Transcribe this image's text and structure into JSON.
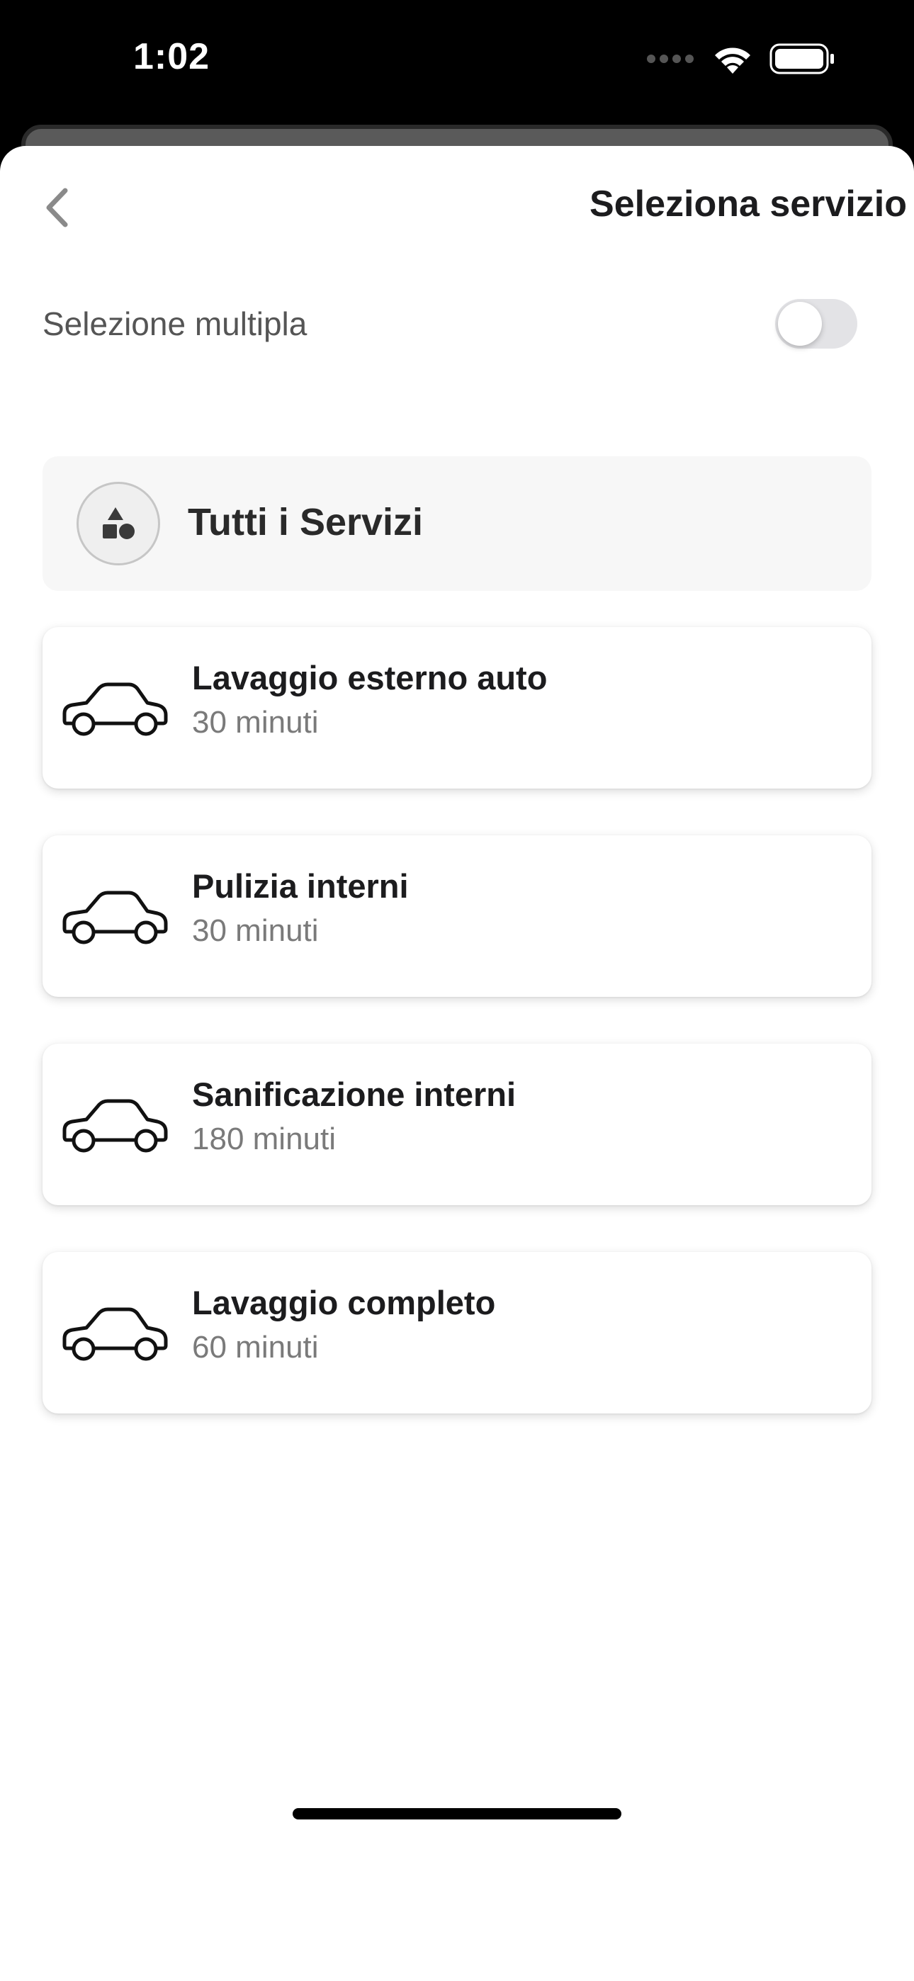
{
  "status_bar": {
    "time": "1:02",
    "icons": [
      "cellular-signal-icon",
      "wifi-icon",
      "battery-icon"
    ]
  },
  "nav": {
    "back_icon": "chevron-left-icon",
    "title": "Seleziona servizio"
  },
  "multi_select": {
    "label": "Selezione multipla",
    "enabled": false
  },
  "all_services": {
    "icon": "shapes-icon",
    "label": "Tutti i Servizi"
  },
  "services": [
    {
      "name": "Lavaggio esterno auto",
      "duration": "30 minuti",
      "icon": "car-icon"
    },
    {
      "name": "Pulizia interni",
      "duration": "30 minuti",
      "icon": "car-icon"
    },
    {
      "name": "Sanificazione interni",
      "duration": "180 minuti",
      "icon": "car-icon"
    },
    {
      "name": "Lavaggio completo",
      "duration": "60 minuti",
      "icon": "car-icon"
    }
  ],
  "colors": {
    "title_text": "#1c1c1e",
    "secondary_text": "#7a7a7a",
    "toggle_off": "#e3e3e6",
    "card_background": "#ffffff",
    "all_services_background": "#f7f7f7"
  }
}
